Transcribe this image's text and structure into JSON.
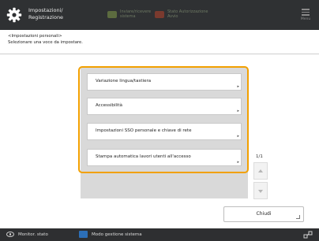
{
  "topbar": {
    "title_line1": "Impostazioni/",
    "title_line2": "Registrazione",
    "status1_line1": "Inviare/ricevere",
    "status1_line2": "sistema",
    "status2_line1": "Stato Autorizzazione",
    "status2_line2": "Avvio",
    "menu_label": "Menu"
  },
  "header": {
    "breadcrumb": "<Impostazioni personali>",
    "instruction": "Selezionare una voce da impostare."
  },
  "items": [
    {
      "label": "Variazione lingua/tastiera"
    },
    {
      "label": "Accessibilità"
    },
    {
      "label": "Impostazioni SSO personale e chiave di rete"
    },
    {
      "label": "Stampa automatica lavori utenti all'accesso"
    }
  ],
  "pager": {
    "text": "1/1"
  },
  "close_button": {
    "label": "Chiudi"
  },
  "bottombar": {
    "status_monitor": "Monitor. stato",
    "system_mode": "Modo gestione sistema"
  },
  "colors": {
    "highlight": "#f2a000",
    "topbar": "#2f3133",
    "accent_blue": "#2c6fb8"
  },
  "icons": {
    "settings": "gear-icon",
    "menu": "menu-icon",
    "status_monitor": "eye-icon",
    "system_mode": "system-mode-icon",
    "network": "network-icon"
  }
}
